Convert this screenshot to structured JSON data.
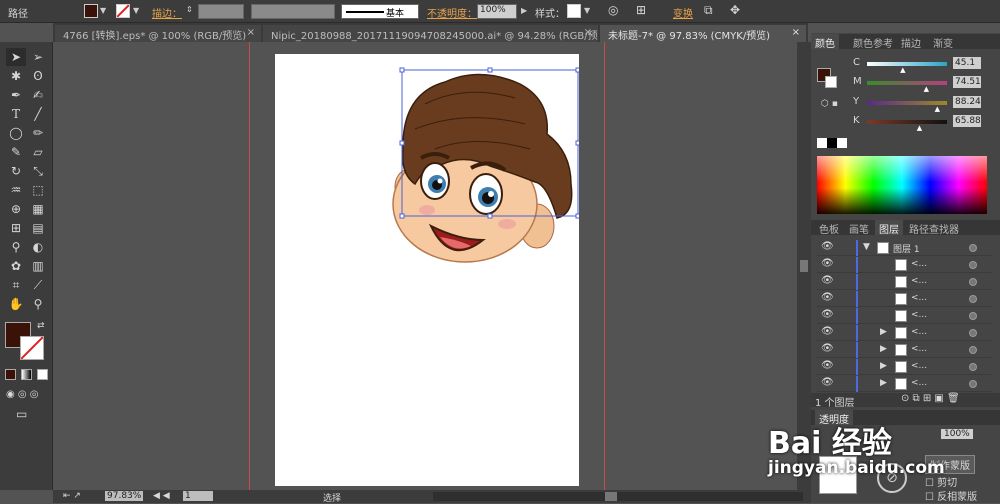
{
  "control": {
    "label": "路径",
    "stroke_label": "描边：",
    "stroke_style": "基本",
    "opacity_label": "不透明度：",
    "opacity_value": "100%",
    "style_label": "样式：",
    "transform_label": "变换"
  },
  "tabs": [
    {
      "label": "4766 [转换].eps* @ 100% (RGB/预览)",
      "close": "×"
    },
    {
      "label": "Nipic_20180988_20171119094708245000.ai* @ 94.28% (RGB/预览)",
      "close": "×"
    },
    {
      "label": "未标题-7* @ 97.83% (CMYK/预览)",
      "close": "×"
    }
  ],
  "status": {
    "zoom": "97.83%",
    "page": "1",
    "tool": "选择"
  },
  "color_panel": {
    "tabs": [
      "颜色",
      "颜色参考",
      "描边",
      "渐变"
    ],
    "channels": [
      {
        "name": "C",
        "value": "45.1",
        "pct": 45.1,
        "color": "#2aa3c8"
      },
      {
        "name": "M",
        "value": "74.51",
        "pct": 74.51,
        "color": "#b5407e"
      },
      {
        "name": "Y",
        "value": "88.24",
        "pct": 88.24,
        "color": "#9a8a2a"
      },
      {
        "name": "K",
        "value": "65.88",
        "pct": 65.88,
        "color": "#666666"
      }
    ],
    "fill_color": "#3b1208"
  },
  "layers_panel": {
    "tabs": [
      "色板",
      "画笔",
      "图层",
      "路径查找器"
    ],
    "layer_name": "图层 1",
    "rows": [
      "<...",
      "<...",
      "<...",
      "<...",
      "<...",
      "<...",
      "<...",
      "<..."
    ],
    "footer": "1 个图层"
  },
  "bottom_panel": {
    "tabs": [
      "透明度"
    ],
    "opacity": "100%",
    "make_mask": "制作蒙版",
    "clip": "剪切",
    "invert": "反相蒙版"
  },
  "watermark": {
    "main": "Bai 经验",
    "sub": "jingyan.baidu.com"
  }
}
